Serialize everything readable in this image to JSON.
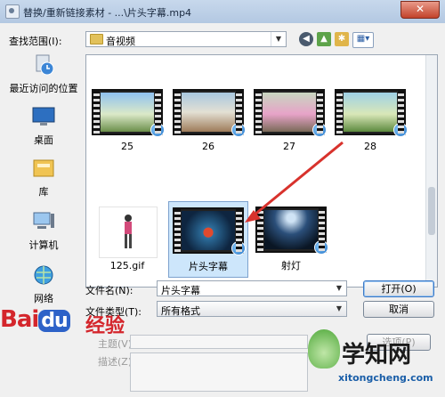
{
  "window": {
    "title": "替换/重新链接素材 - ...\\片头字幕.mp4",
    "close_glyph": "✕"
  },
  "lookin": {
    "label": "查找范围(I):",
    "value": "音视频"
  },
  "toolbar": {
    "back_glyph": "◀",
    "up_glyph": "▲",
    "newfolder_glyph": "✱",
    "view_glyph": "▦▾"
  },
  "places": [
    {
      "label": "最近访问的位置",
      "icon": "recent-places-icon"
    },
    {
      "label": "桌面",
      "icon": "desktop-icon"
    },
    {
      "label": "库",
      "icon": "library-icon"
    },
    {
      "label": "计算机",
      "icon": "computer-icon"
    },
    {
      "label": "网络",
      "icon": "network-icon"
    }
  ],
  "files": [
    {
      "label": "25"
    },
    {
      "label": "26"
    },
    {
      "label": "27"
    },
    {
      "label": "28"
    },
    {
      "label": "125.gif"
    },
    {
      "label": "片头字幕"
    },
    {
      "label": "射灯"
    }
  ],
  "filename": {
    "label": "文件名(N):",
    "value": "片头字幕",
    "open": "打开(O)"
  },
  "filetype": {
    "label": "文件类型(T):",
    "value": "所有格式",
    "cancel": "取消"
  },
  "meta": {
    "subject": "主题(V):",
    "desc": "描述(Z):",
    "options": "选项(P)"
  },
  "watermarks": {
    "baidu_a": "Bai",
    "baidu_du": "du",
    "jingyan": "经验",
    "xitong": "学知网",
    "url": "xitongcheng.com"
  },
  "colors": {
    "selection": "#cde6fb",
    "accent": "#3b79c7",
    "arrow": "#d8322c"
  }
}
